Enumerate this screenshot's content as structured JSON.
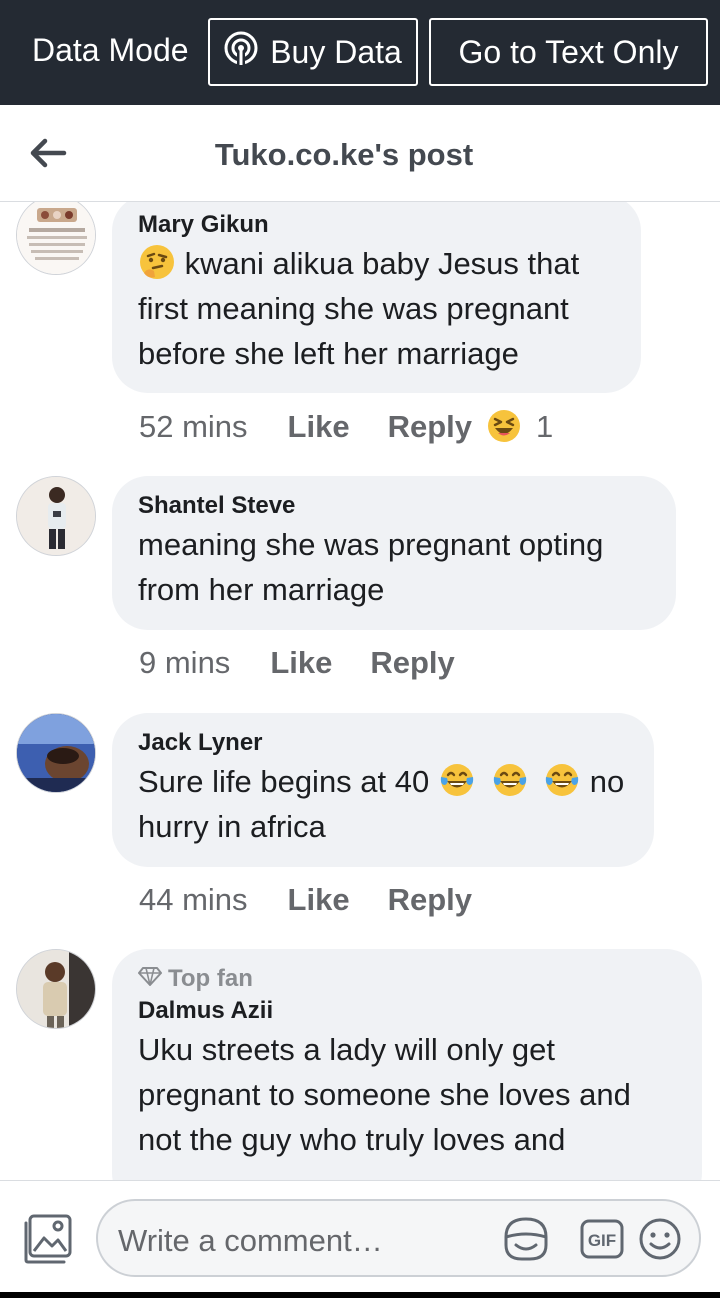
{
  "topbar": {
    "mode_label": "Data Mode",
    "buy_label": "Buy Data",
    "text_only_label": "Go to Text Only"
  },
  "header": {
    "title": "Tuko.co.ke's post"
  },
  "comments": [
    {
      "author": "Mary Gikun",
      "text": "kwani alikua baby Jesus that first meaning she was pregnant before she left her marriage",
      "time": "52 mins",
      "like": "Like",
      "reply": "Reply",
      "reaction_count": "1"
    },
    {
      "author": "Shantel Steve",
      "text": "meaning she was pregnant opting from her marriage",
      "time": "9 mins",
      "like": "Like",
      "reply": "Reply"
    },
    {
      "author": "Jack Lyner",
      "text_part1": "Sure life begins at 40",
      "text_part2": "no hurry in africa",
      "time": "44 mins",
      "like": "Like",
      "reply": "Reply"
    },
    {
      "badge": "Top fan",
      "author": "Dalmus Azii",
      "text": "Uku streets a lady will only get pregnant to someone she loves and not the guy who truly loves and"
    }
  ],
  "composer": {
    "placeholder": "Write a comment…"
  },
  "icons": {
    "back": "arrow-left-icon",
    "buy": "signal-broadcast-icon",
    "photo": "photo-icon",
    "sticker": "sticker-icon",
    "gif": "gif-icon",
    "emoji": "smiley-icon"
  }
}
